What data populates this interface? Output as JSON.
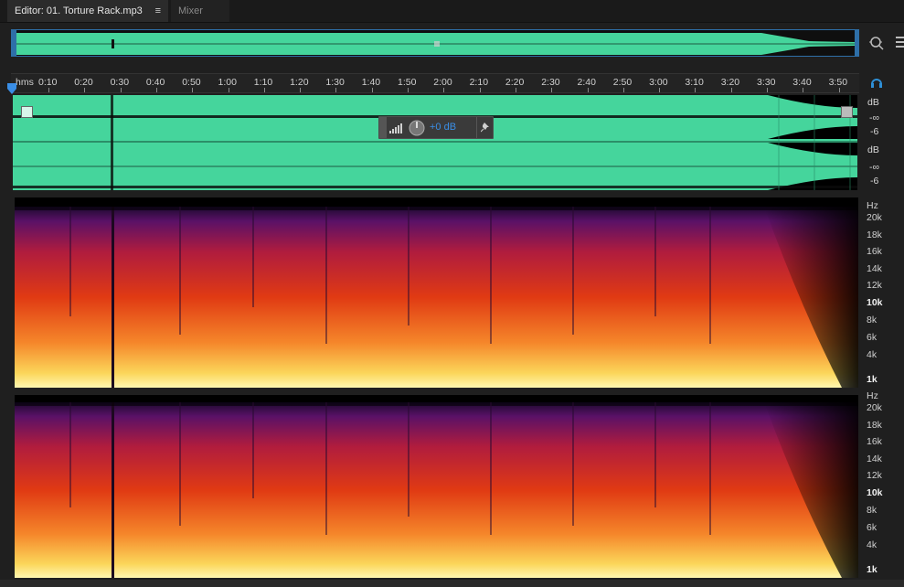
{
  "tabs": {
    "editor_label": "Editor: 01. Torture Rack.mp3",
    "editor_menu_icon": "≡",
    "mixer_label": "Mixer"
  },
  "ruler": {
    "unit": "hms",
    "ticks": [
      "0:10",
      "0:20",
      "0:30",
      "0:40",
      "0:50",
      "1:00",
      "1:10",
      "1:20",
      "1:30",
      "1:40",
      "1:50",
      "2:00",
      "2:10",
      "2:20",
      "2:30",
      "2:40",
      "2:50",
      "3:00",
      "3:10",
      "3:20",
      "3:30",
      "3:40",
      "3:50"
    ]
  },
  "hud": {
    "value": "+0 dB"
  },
  "db_scale": {
    "channel_1": [
      "dB",
      "-∞",
      "-6"
    ],
    "channel_2": [
      "dB",
      "-∞",
      "-6"
    ]
  },
  "freq_scale": {
    "unit": "Hz",
    "labels": [
      "20k",
      "18k",
      "16k",
      "14k",
      "12k",
      "10k",
      "8k",
      "6k",
      "4k",
      "1k"
    ]
  },
  "colors": {
    "waveform": "#45d59c",
    "accent": "#2e6fa8",
    "hud_value": "#3a8ee6"
  },
  "icons": [
    "zoom-icon",
    "right-panel-icon",
    "headphones-icon",
    "playhead-marker-icon",
    "volume-meter-icon",
    "volume-knob-icon",
    "pin-icon",
    "fade-in-handle-icon",
    "fade-out-handle-icon"
  ]
}
